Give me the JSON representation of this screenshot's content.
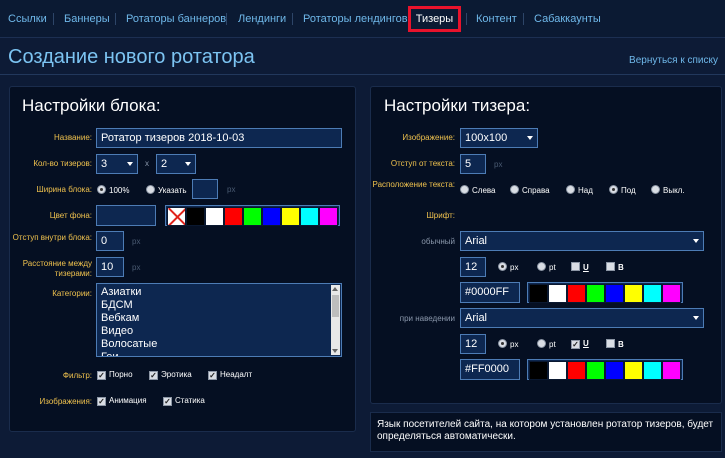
{
  "nav": {
    "items": [
      "Ссылки",
      "Баннеры",
      "Ротаторы баннеров",
      "Лендинги",
      "Ротаторы лендингов",
      "Тизеры",
      "Контент",
      "Сабаккаунты"
    ],
    "active": "Тизеры"
  },
  "page": {
    "title": "Создание нового ротатора",
    "back_link": "Вернуться к списку"
  },
  "block": {
    "title": "Настройки блока:",
    "name_label": "Название:",
    "name_value": "Ротатор тизеров 2018-10-03",
    "count_label": "Кол-во тизеров:",
    "count_cols": "3",
    "count_x": "x",
    "count_rows": "2",
    "width_label": "Ширина блока:",
    "width_opt_full": "100%",
    "width_opt_custom": "Указать",
    "width_unit": "px",
    "bg_label": "Цвет фона:",
    "bg_value": "",
    "palette": [
      "none",
      "#000000",
      "#ffffff",
      "#ff0000",
      "#00ff00",
      "#0000ff",
      "#ffff00",
      "#00ffff",
      "#ff00ff"
    ],
    "padding_label": "Отступ внутри блока:",
    "padding_value": "0",
    "padding_unit": "px",
    "spacing_label": "Расстояние между тизерами:",
    "spacing_value": "10",
    "spacing_unit": "px",
    "categories_label": "Категории:",
    "categories": [
      "Азиатки",
      "БДСМ",
      "Вебкам",
      "Видео",
      "Волосатые",
      "Геи"
    ],
    "filter_label": "Фильтр:",
    "filter_opts": [
      "Порно",
      "Эротика",
      "Неадалт"
    ],
    "images_label": "Изображения:",
    "images_opts": [
      "Анимация",
      "Статика"
    ]
  },
  "teaser": {
    "title": "Настройки тизера:",
    "image_label": "Изображение:",
    "image_value": "100x100",
    "text_offset_label": "Отступ от текста:",
    "text_offset_value": "5",
    "text_offset_unit": "px",
    "text_pos_label": "Расположение текста:",
    "text_pos_opts": [
      "Слева",
      "Справа",
      "Над",
      "Под",
      "Выкл."
    ],
    "text_pos_selected": "Под",
    "font_label": "Шрифт:",
    "normal_label": "обычный",
    "normal_font": "Arial",
    "normal_size": "12",
    "normal_units": [
      "px",
      "pt"
    ],
    "normal_u": "U",
    "normal_b": "B",
    "normal_color": "#0000FF",
    "hover_label": "при наведении",
    "hover_font": "Arial",
    "hover_size": "12",
    "hover_units": [
      "px",
      "pt"
    ],
    "hover_u": "U",
    "hover_b": "B",
    "hover_color": "#FF0000",
    "palette": [
      "#000000",
      "#ffffff",
      "#ff0000",
      "#00ff00",
      "#0000ff",
      "#ffff00",
      "#00ffff",
      "#ff00ff"
    ]
  },
  "note": "Язык посетителей сайта, на котором установлен ротатор тизеров, будет определяться автоматически."
}
